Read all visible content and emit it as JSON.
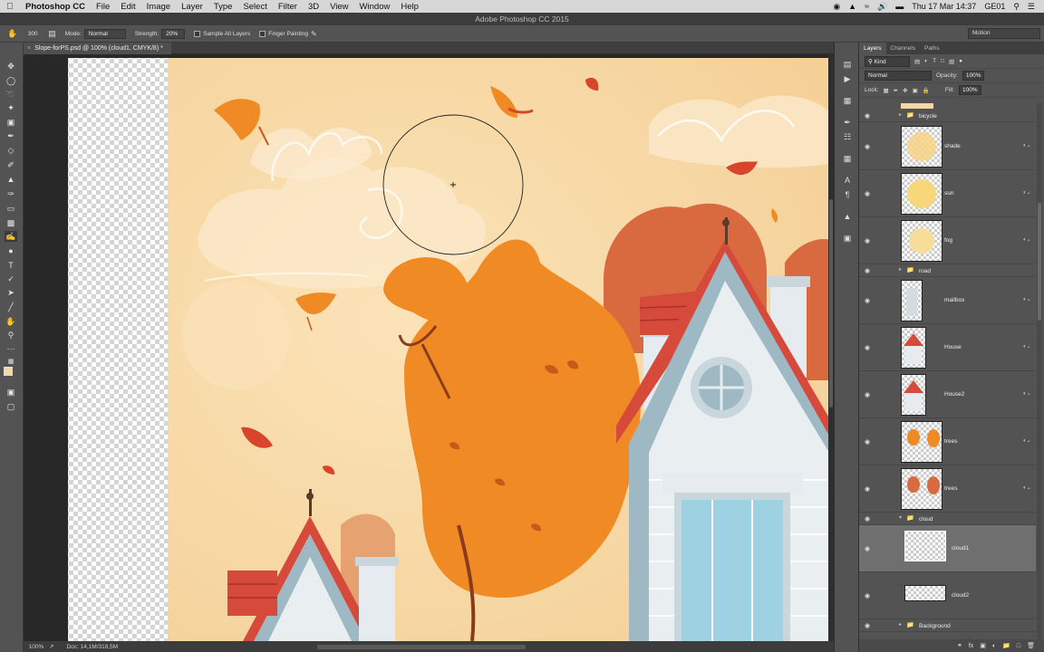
{
  "menubar": {
    "apple_icon": "apple-icon",
    "app_name": "Photoshop CC",
    "items": [
      "File",
      "Edit",
      "Image",
      "Layer",
      "Type",
      "Select",
      "Filter",
      "3D",
      "View",
      "Window",
      "Help"
    ],
    "clock": "Thu 17 Mar  14:37",
    "user": "GE01"
  },
  "window": {
    "title": "Adobe Photoshop CC 2015"
  },
  "options_bar": {
    "brush_size": "300",
    "mode_label": "Mode:",
    "mode_value": "Normal",
    "strength_label": "Strength:",
    "strength_value": "20%",
    "sample_all_layers": "Sample All Layers",
    "finger_painting": "Finger Painting",
    "workspace": "Motion"
  },
  "document": {
    "tab_title": "Slope-forPS.psd @ 100% (cloud1, CMYK/8) *"
  },
  "status": {
    "zoom": "100%",
    "doc_info": "Doc: 14,1M/318,5M"
  },
  "panel": {
    "tabs": [
      "Layers",
      "Channels",
      "Paths"
    ],
    "filter_kind": "Kind",
    "blend_mode": "Normal",
    "opacity_label": "Opacity:",
    "opacity_value": "100%",
    "lock_label": "Lock:",
    "fill_label": "Fill:",
    "fill_value": "100%"
  },
  "layers": [
    {
      "name": "bicycle",
      "type": "group"
    },
    {
      "name": "shade",
      "type": "layer"
    },
    {
      "name": "sun",
      "type": "layer"
    },
    {
      "name": "fog",
      "type": "layer"
    },
    {
      "name": "road",
      "type": "group"
    },
    {
      "name": "mailbox",
      "type": "layer"
    },
    {
      "name": "House",
      "type": "layer"
    },
    {
      "name": "House2",
      "type": "layer"
    },
    {
      "name": "trees",
      "type": "layer"
    },
    {
      "name": "trees",
      "type": "layer"
    },
    {
      "name": "cloud",
      "type": "group-open"
    },
    {
      "name": "cloud1",
      "type": "layer",
      "selected": true
    },
    {
      "name": "cloud2",
      "type": "layer"
    },
    {
      "name": "Background",
      "type": "group"
    }
  ],
  "colors": {
    "sky": "#f6d6a0",
    "orange": "#f08a24",
    "red_leaf": "#d9452a",
    "house_blue": "#9fb9c4",
    "roof_red": "#d64a3c"
  },
  "icons": [
    "move-tool-icon",
    "marquee-tool-icon",
    "lasso-tool-icon",
    "crop-tool-icon",
    "brush-tool-icon",
    "smudge-tool-icon",
    "type-tool-icon",
    "zoom-tool-icon",
    "eye-icon",
    "folder-icon"
  ]
}
